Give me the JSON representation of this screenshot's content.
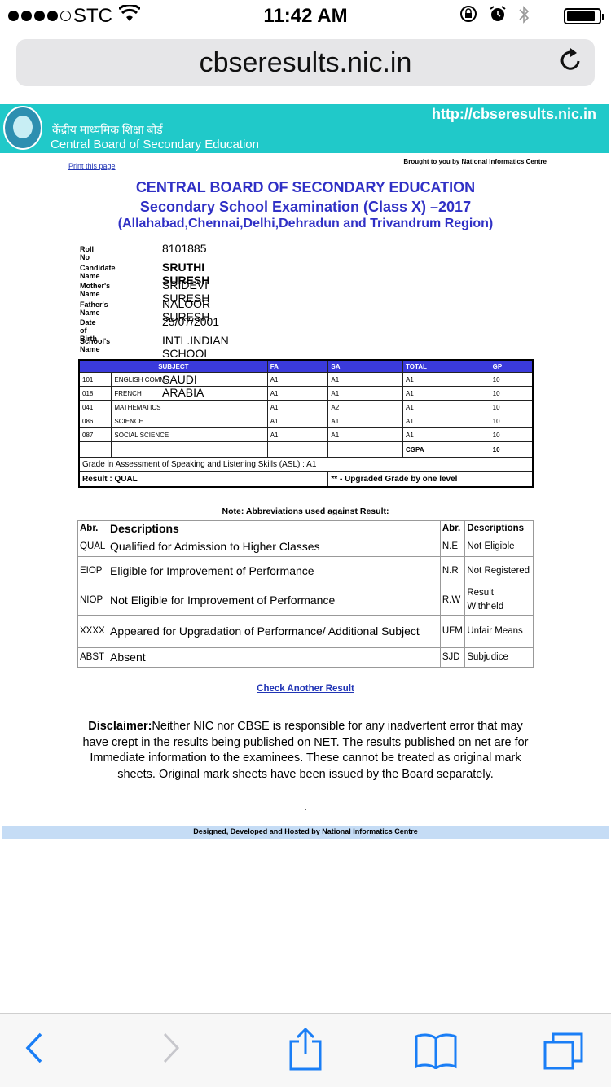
{
  "status_bar": {
    "carrier": "STC",
    "time": "11:42 AM"
  },
  "browser": {
    "url": "cbseresults.nic.in"
  },
  "header": {
    "hindi_name": "केंद्रीय माध्यमिक शिक्षा बोर्ड",
    "english_name": "Central Board of Secondary Education",
    "url": "http://cbseresults.nic.in"
  },
  "page": {
    "print_link": "Print this page",
    "brought_by": "Brought to you by National Informatics Centre",
    "title1": "CENTRAL BOARD OF SECONDARY EDUCATION",
    "title2": "Secondary School Examination (Class X) –2017",
    "title3": "(Allahabad,Chennai,Delhi,Dehradun and Trivandrum Region)"
  },
  "candidate": {
    "roll_label": "Roll No",
    "roll": "8101885",
    "name_label": "Candidate Name",
    "name": "SRUTHI SURESH",
    "mother_label": "Mother's Name",
    "mother": "SRIDEVI SURESH",
    "father_label": "Father's Name",
    "father": "NALOOR SURESH",
    "dob_label": "Date of Birth",
    "dob": "25/07/2001",
    "school_label": "School's Name",
    "school": "INTL.INDIAN SCHOOL AL-KHOBAR SAUDI ARABIA"
  },
  "marks": {
    "headers": {
      "subject": "SUBJECT",
      "fa": "FA",
      "sa": "SA",
      "total": "TOTAL",
      "gp": "GP"
    },
    "rows": [
      {
        "code": "101",
        "subject": "ENGLISH COMM.",
        "fa": "A1",
        "sa": "A1",
        "total": "A1",
        "gp": "10"
      },
      {
        "code": "018",
        "subject": "FRENCH",
        "fa": "A1",
        "sa": "A1",
        "total": "A1",
        "gp": "10"
      },
      {
        "code": "041",
        "subject": "MATHEMATICS",
        "fa": "A1",
        "sa": "A2",
        "total": "A1",
        "gp": "10"
      },
      {
        "code": "086",
        "subject": "SCIENCE",
        "fa": "A1",
        "sa": "A1",
        "total": "A1",
        "gp": "10"
      },
      {
        "code": "087",
        "subject": "SOCIAL SCIENCE",
        "fa": "A1",
        "sa": "A1",
        "total": "A1",
        "gp": "10"
      }
    ],
    "cgpa_label": "CGPA",
    "cgpa": "10",
    "asl": "Grade in Assessment of Speaking and Listening Skills (ASL) : A1",
    "result": "Result : QUAL",
    "upgrade_note": "** - Upgraded Grade by one level"
  },
  "abbreviations": {
    "note": "Note: Abbreviations used against Result:",
    "h_abr": "Abr.",
    "h_desc": "Descriptions",
    "rows": [
      {
        "a1": "QUAL",
        "d1": "Qualified for Admission to Higher Classes",
        "a2": "N.E",
        "d2": "Not Eligible"
      },
      {
        "a1": "EIOP",
        "d1": "Eligible for Improvement of Performance",
        "a2": "N.R",
        "d2": "Not Registered"
      },
      {
        "a1": "NIOP",
        "d1": "Not Eligible for Improvement of Performance",
        "a2": "R.W",
        "d2": "Result Withheld"
      },
      {
        "a1": "XXXX",
        "d1": "Appeared for Upgradation of Performance/ Additional Subject",
        "a2": "UFM",
        "d2": "Unfair Means"
      },
      {
        "a1": "ABST",
        "d1": "Absent",
        "a2": "SJD",
        "d2": "Subjudice"
      }
    ]
  },
  "check_another": "Check Another Result",
  "disclaimer": {
    "label": "Disclaimer:",
    "text": "Neither NIC nor CBSE is responsible for any inadvertent error that may have crept in the results being published on NET. The results published on net are for Immediate information to the examinees. These cannot be treated as original mark sheets. Original mark sheets have been issued by the Board separately."
  },
  "period": ".",
  "footer": "Designed, Developed and Hosted by National Informatics Centre",
  "icons": {
    "signal": "signal-dots-icon",
    "wifi": "wifi-icon",
    "lock_rotation": "rotation-lock-icon",
    "alarm": "alarm-icon",
    "bluetooth": "bluetooth-icon",
    "battery": "battery-icon",
    "reload": "reload-icon",
    "back": "back-icon",
    "forward": "forward-icon",
    "share": "share-icon",
    "bookmarks": "bookmarks-icon",
    "tabs": "tabs-icon"
  },
  "colors": {
    "header_bg": "#20c9c9",
    "title": "#3030c5",
    "table_header": "#3a3adb",
    "link": "#2034b5",
    "footer_bg": "#c5dcf5",
    "ios_blue": "#1a7ef6"
  }
}
